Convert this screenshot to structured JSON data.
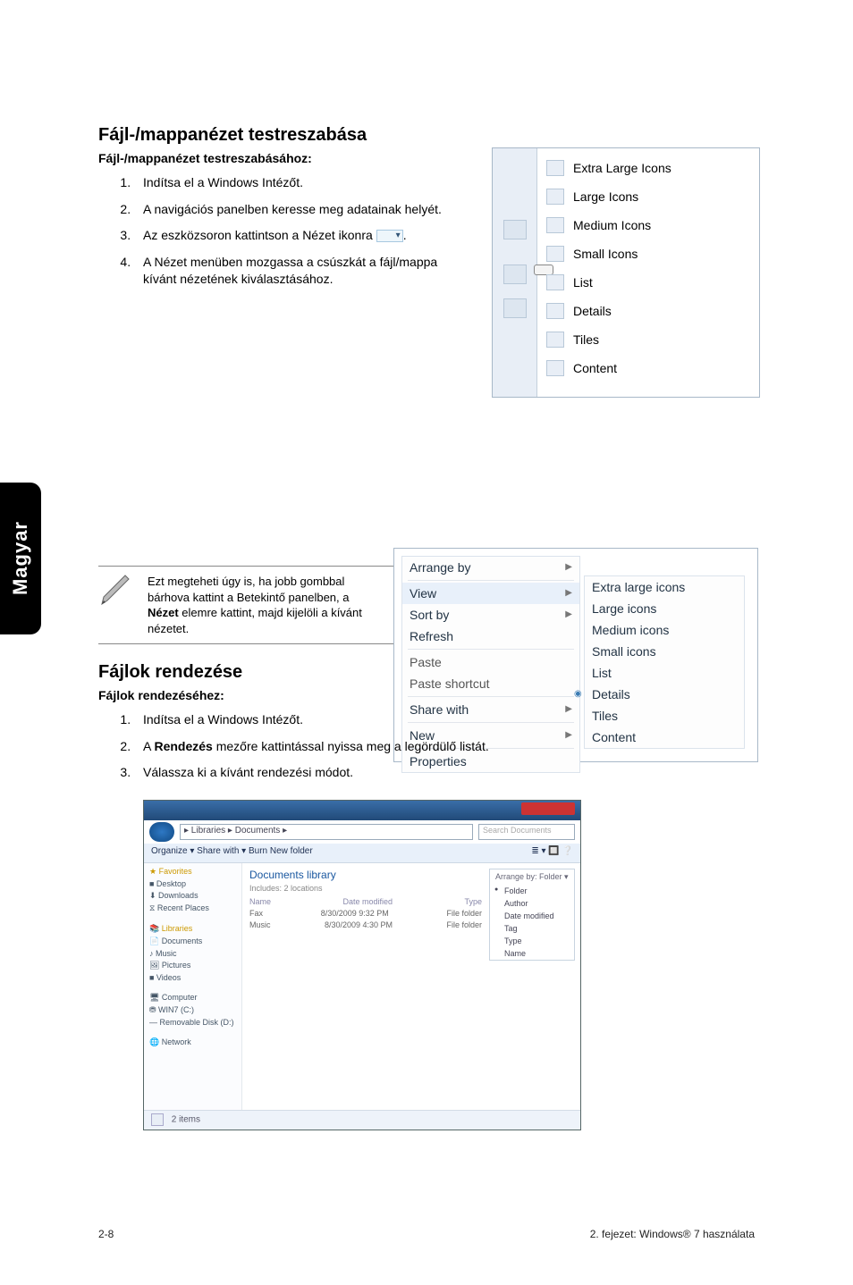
{
  "h_customize": "Fájl-/mappanézet testreszabása",
  "sub_customize": "Fájl-/mappanézet testreszabásához:",
  "steps_customize": [
    "Indítsa el a Windows Intézőt.",
    "A navigációs panelben keresse meg adatainak helyét.",
    "Az eszközsoron kattintson a Nézet ikonra ",
    "A Nézet menüben mozgassa a csúszkát a fájl/mappa kívánt nézetének kiválasztásához."
  ],
  "view_items": [
    "Extra Large Icons",
    "Large Icons",
    "Medium Icons",
    "Small Icons",
    "List",
    "Details",
    "Tiles",
    "Content"
  ],
  "tip_1": "Ezt megteheti úgy is, ha jobb gombbal bárhova kattint a Betekintő panelben, a ",
  "tip_bold": "Nézet",
  "tip_2": " elemre kattint, majd kijelöli a kívánt nézetet.",
  "ctx_left": {
    "arrange": "Arrange by",
    "view": "View",
    "sort": "Sort by",
    "refresh": "Refresh",
    "paste": "Paste",
    "paste_sc": "Paste shortcut",
    "share": "Share with",
    "new": "New",
    "props": "Properties"
  },
  "ctx_right": [
    "Extra large icons",
    "Large icons",
    "Medium icons",
    "Small icons",
    "List",
    "Details",
    "Tiles",
    "Content"
  ],
  "h_sort": "Fájlok rendezése",
  "sub_sort": "Fájlok rendezéséhez:",
  "steps_sort_1": "Indítsa el a Windows Intézőt.",
  "steps_sort_2a": "A ",
  "steps_sort_2b": "Rendezés",
  "steps_sort_2c": " mezőre kattintással nyissa meg a legördülő listát.",
  "steps_sort_3": "Válassza ki a kívánt rendezési módot.",
  "lib": {
    "address": "▸ Libraries ▸ Documents ▸",
    "search_ph": "Search Documents",
    "toolbar_left": "Organize ▾    Share with ▾    Burn    New folder",
    "header_blue": "Documents library",
    "header_sub": "Includes: 2 locations",
    "cols": {
      "name": "Name",
      "date": "Date modified",
      "type": "Type"
    },
    "rows": [
      {
        "n": "Fax",
        "d": "8/30/2009 9:32 PM",
        "t": "File folder"
      },
      {
        "n": "Music",
        "d": "8/30/2009 4:30 PM",
        "t": "File folder"
      }
    ],
    "arrange_label": "Arrange by:  Folder ▾",
    "arrange_opts": [
      "Folder",
      "Author",
      "Date modified",
      "Tag",
      "Type",
      "Name"
    ],
    "status": "2 items"
  },
  "sidebar_items": {
    "fav": "★ Favorites",
    "desk": "■ Desktop",
    "down": "⬇ Downloads",
    "recent": "⧖ Recent Places",
    "libs": "📚 Libraries",
    "docs": "📄 Documents",
    "music": "♪ Music",
    "pics": "🖼 Pictures",
    "vids": "■ Videos",
    "comp": "🖥 Computer",
    "c": "⛃ WIN7 (C:)",
    "d": "— Removable Disk (D:)",
    "net": "🌐 Network"
  },
  "tab_label": "Magyar",
  "footer_left": "2-8",
  "footer_right": "2. fejezet: Windows® 7 használata"
}
